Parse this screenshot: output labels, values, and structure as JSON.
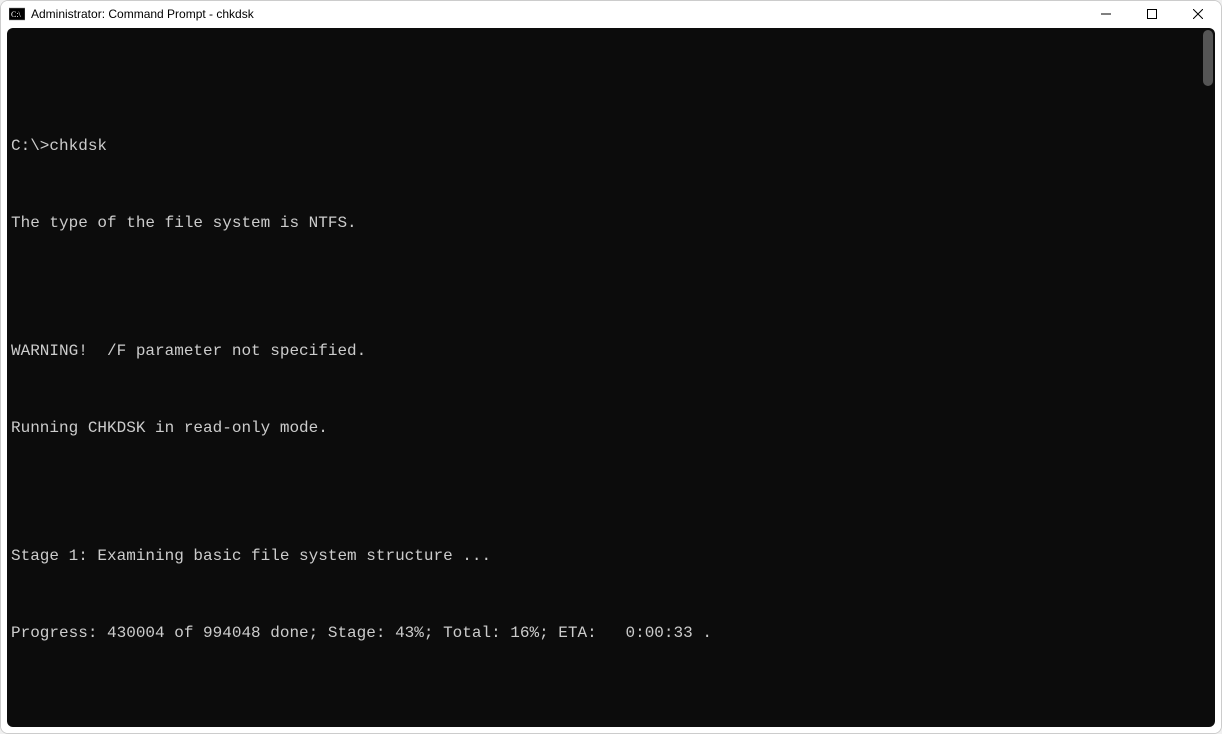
{
  "window": {
    "title": "Administrator: Command Prompt - chkdsk"
  },
  "console": {
    "lines": [
      "",
      "C:\\>chkdsk",
      "The type of the file system is NTFS.",
      "",
      "WARNING!  /F parameter not specified.",
      "Running CHKDSK in read-only mode.",
      "",
      "Stage 1: Examining basic file system structure ...",
      "Progress: 430004 of 994048 done; Stage: 43%; Total: 16%; ETA:   0:00:33 ."
    ]
  }
}
